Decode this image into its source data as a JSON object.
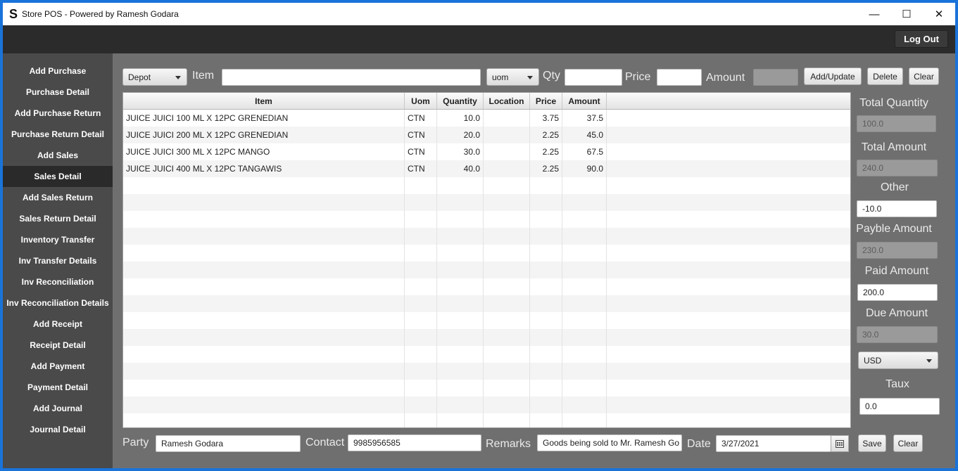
{
  "window": {
    "logo": "S",
    "title": "Store POS - Powered by Ramesh Godara",
    "minimize": "—",
    "maximize": "☐",
    "close": "✕"
  },
  "topbar": {
    "logout_label": "Log Out"
  },
  "sidebar": {
    "items": [
      {
        "label": "Add Purchase"
      },
      {
        "label": "Purchase Detail"
      },
      {
        "label": "Add Purchase Return"
      },
      {
        "label": "Purchase Return Detail"
      },
      {
        "label": "Add Sales"
      },
      {
        "label": "Sales Detail"
      },
      {
        "label": "Add Sales Return"
      },
      {
        "label": "Sales Return Detail"
      },
      {
        "label": "Inventory Transfer"
      },
      {
        "label": "Inv Transfer Details"
      },
      {
        "label": "Inv Reconciliation"
      },
      {
        "label": "Inv Reconciliation Details"
      },
      {
        "label": "Add Receipt"
      },
      {
        "label": "Receipt Detail"
      },
      {
        "label": "Add Payment"
      },
      {
        "label": "Payment Detail"
      },
      {
        "label": "Add Journal"
      },
      {
        "label": "Journal Detail"
      }
    ],
    "active_item": "Sales Detail"
  },
  "entry_bar": {
    "location_select": "Depot",
    "item_label": "Item",
    "item_value": "",
    "uom_select": "uom",
    "qty_label": "Qty",
    "qty_value": "",
    "price_label": "Price",
    "price_value": "",
    "amount_label": "Amount",
    "amount_value": "",
    "add_update_label": "Add/Update",
    "delete_label": "Delete",
    "clear_label": "Clear"
  },
  "table": {
    "columns": [
      "Item",
      "Uom",
      "Quantity",
      "Location",
      "Price",
      "Amount"
    ],
    "rows": [
      {
        "item": "JUICE JUICI 100 ML X 12PC GRENEDIAN",
        "uom": "CTN",
        "quantity": "10.0",
        "location": "",
        "price": "3.75",
        "amount": "37.5"
      },
      {
        "item": "JUICE JUICI 200 ML X 12PC GRENEDIAN",
        "uom": "CTN",
        "quantity": "20.0",
        "location": "",
        "price": "2.25",
        "amount": "45.0"
      },
      {
        "item": "JUICE JUICI 300 ML X 12PC MANGO",
        "uom": "CTN",
        "quantity": "30.0",
        "location": "",
        "price": "2.25",
        "amount": "67.5"
      },
      {
        "item": "JUICE JUICI 400 ML X 12PC TANGAWIS",
        "uom": "CTN",
        "quantity": "40.0",
        "location": "",
        "price": "2.25",
        "amount": "90.0"
      }
    ]
  },
  "summary": {
    "total_quantity_label": "Total Quantity",
    "total_quantity": "100.0",
    "total_amount_label": "Total Amount",
    "total_amount": "240.0",
    "other_label": "Other",
    "other": "-10.0",
    "payable_label": "Payble Amount",
    "payable": "230.0",
    "paid_label": "Paid Amount",
    "paid": "200.0",
    "due_label": "Due Amount",
    "due": "30.0",
    "currency": "USD",
    "taux_label": "Taux",
    "taux": "0.0"
  },
  "footer": {
    "party_label": "Party",
    "party": "Ramesh Godara",
    "contact_label": "Contact",
    "contact": "9985956585",
    "remarks_label": "Remarks",
    "remarks": "Goods being sold to Mr. Ramesh Go",
    "date_label": "Date",
    "date": "3/27/2021",
    "save_label": "Save",
    "clear_label": "Clear"
  },
  "colors": {
    "sidebar_bg": "#4a4a4a",
    "active_item_bg": "#2a2a2a",
    "main_bg": "#6f6f6f",
    "topbar_bg": "#2b2b2b",
    "desktop_border": "#1a73d9"
  },
  "icons": {
    "calendar": "calendar-icon",
    "dropdown": "chevron-down-icon"
  }
}
